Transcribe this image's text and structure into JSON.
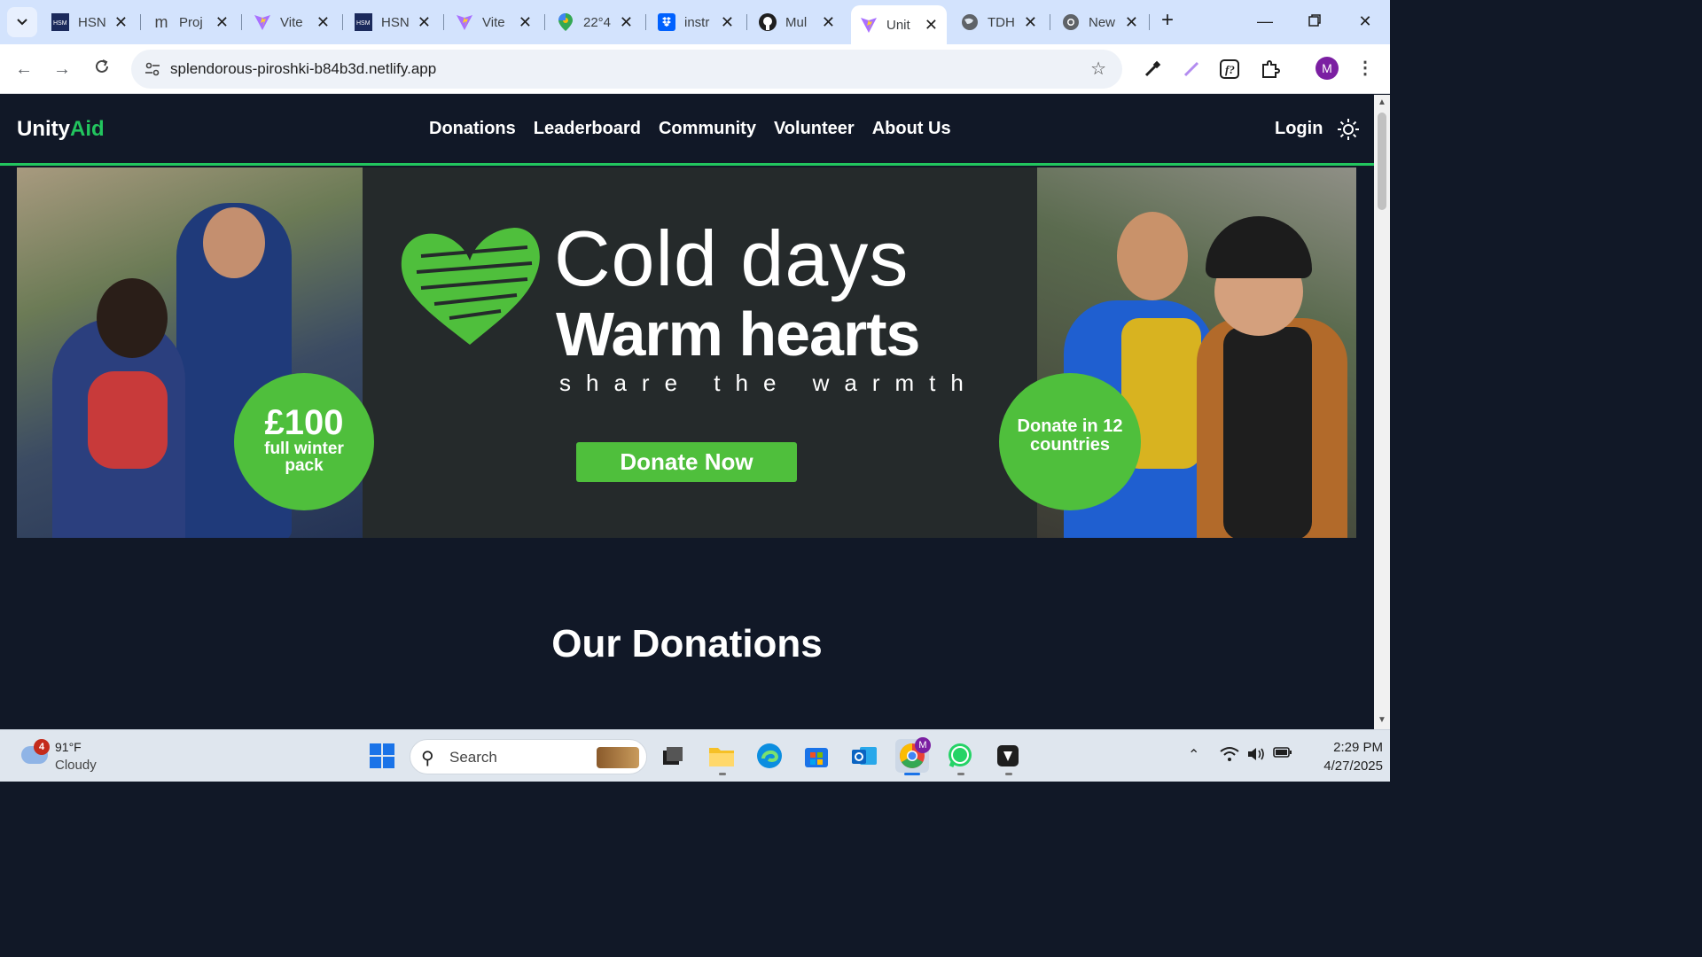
{
  "browser": {
    "tabs": [
      {
        "label": "HSN",
        "icon": "hsm-icon"
      },
      {
        "label": "Proj",
        "icon": "m-icon"
      },
      {
        "label": "Vite",
        "icon": "vite-icon"
      },
      {
        "label": "HSN",
        "icon": "hsm-icon"
      },
      {
        "label": "Vite",
        "icon": "vite-icon"
      },
      {
        "label": "22°4",
        "icon": "maps-icon"
      },
      {
        "label": "instr",
        "icon": "dropbox-icon"
      },
      {
        "label": "Mul",
        "icon": "github-icon"
      },
      {
        "label": "Unit",
        "icon": "vite-icon",
        "active": true
      },
      {
        "label": "TDH",
        "icon": "globe-icon"
      },
      {
        "label": "New",
        "icon": "chrome-icon"
      }
    ],
    "url": "splendorous-piroshki-b84b3d.netlify.app",
    "profile_initial": "M"
  },
  "site": {
    "brand_main": "Unity",
    "brand_accent": "Aid",
    "nav": [
      "Donations",
      "Leaderboard",
      "Community",
      "Volunteer",
      "About Us"
    ],
    "login": "Login"
  },
  "banner": {
    "line1": "Cold days",
    "line2": "Warm hearts",
    "line3": "share the warmth",
    "cta": "Donate Now",
    "badge_left_big": "£100",
    "badge_left_small": "full winter pack",
    "badge_right": "Donate in 12 countries"
  },
  "section_title": "Our Donations",
  "taskbar": {
    "weather_temp": "91°F",
    "weather_cond": "Cloudy",
    "weather_badge": "4",
    "search_placeholder": "Search",
    "time": "2:29 PM",
    "date": "4/27/2025"
  },
  "colors": {
    "accent_green": "#22c55e",
    "banner_green": "#4fbf3c",
    "page_bg": "#111827",
    "tabstrip_bg": "#d3e3fd"
  }
}
